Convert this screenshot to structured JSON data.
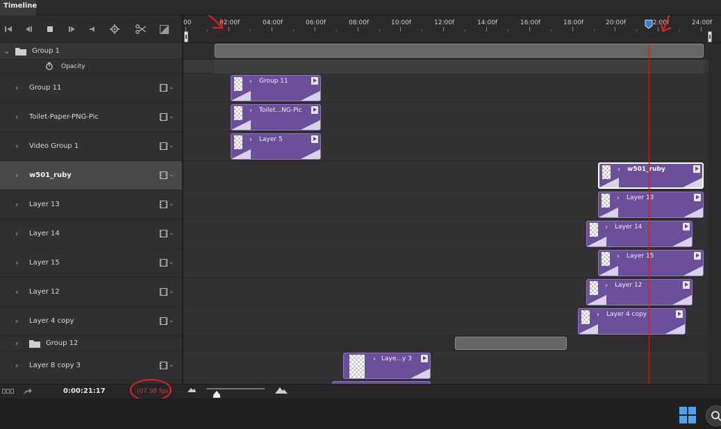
{
  "panel": {
    "tab_title": "Timeline"
  },
  "ruler": {
    "labels": [
      "00",
      "02:00f",
      "04:00f",
      "06:00f",
      "08:00f",
      "10:00f",
      "12:00f",
      "14:00f",
      "16:00f",
      "18:00f",
      "20:00f",
      "22:00f",
      "24:00f"
    ]
  },
  "layers": [
    {
      "name": "Group 1",
      "kind": "group-open"
    },
    {
      "name": "Opacity",
      "kind": "property"
    },
    {
      "name": "Group 11",
      "kind": "video"
    },
    {
      "name": "Toilet-Paper-PNG-Pic",
      "kind": "video"
    },
    {
      "name": "Video Group 1",
      "kind": "video"
    },
    {
      "name": "w501_ruby",
      "kind": "video",
      "selected": true
    },
    {
      "name": "Layer 13",
      "kind": "video"
    },
    {
      "name": "Layer 14",
      "kind": "video"
    },
    {
      "name": "Layer 15",
      "kind": "video"
    },
    {
      "name": "Layer 12",
      "kind": "video"
    },
    {
      "name": "Layer 4 copy",
      "kind": "video"
    },
    {
      "name": "Group 12",
      "kind": "group-closed"
    },
    {
      "name": "Layer 8 copy 3",
      "kind": "video"
    }
  ],
  "clips": [
    {
      "label": "Group 11"
    },
    {
      "label": "Toilet...NG-Pic"
    },
    {
      "label": "Layer 5"
    },
    {
      "label": "w501_ruby"
    },
    {
      "label": "Layer 13"
    },
    {
      "label": "Layer 14"
    },
    {
      "label": "Layer 15"
    },
    {
      "label": "Layer 12"
    },
    {
      "label": "Layer 4 copy"
    },
    {
      "label": "Laye...y 3"
    }
  ],
  "status": {
    "timecode": "0:00:21:17",
    "fps": "(07.98 fps)"
  },
  "colors": {
    "clip": "#6b4f9a",
    "playhead": "#c8201c",
    "annotation": "#e02020"
  }
}
